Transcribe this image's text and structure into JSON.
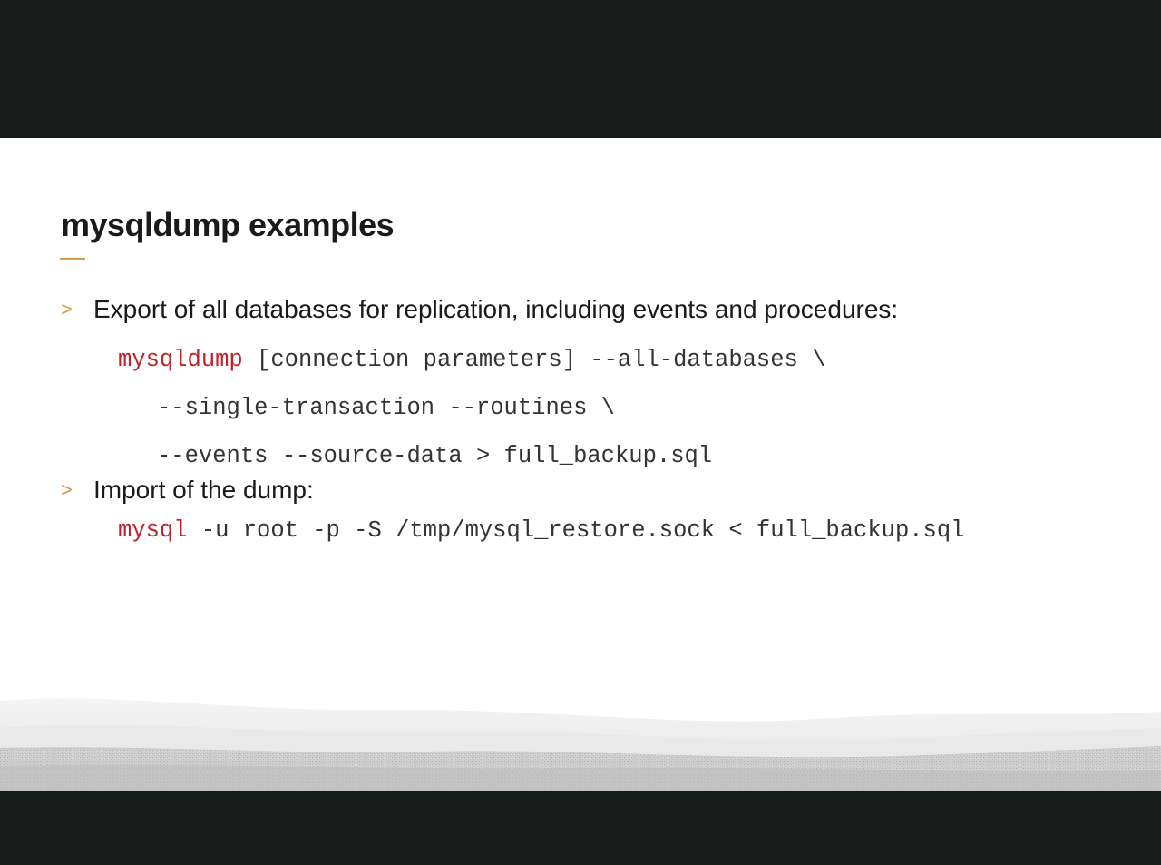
{
  "slide": {
    "title": "mysqldump examples",
    "bullets": [
      {
        "marker": ">",
        "text": "Export of all databases for replication, including events and procedures:"
      },
      {
        "marker": ">",
        "text": "Import of the dump:"
      }
    ],
    "code_lines": [
      {
        "command": "mysqldump",
        "rest": " [connection parameters] --all-databases \\"
      },
      {
        "command": "",
        "rest": "--single-transaction --routines \\"
      },
      {
        "command": "",
        "rest": "--events --source-data > full_backup.sql"
      },
      {
        "command": "mysql",
        "rest": " -u root -p -S /tmp/mysql_restore.sock < full_backup.sql"
      }
    ]
  },
  "colors": {
    "accent": "#d99b4b",
    "command": "#c0222b",
    "letterbox": "#161b19"
  }
}
